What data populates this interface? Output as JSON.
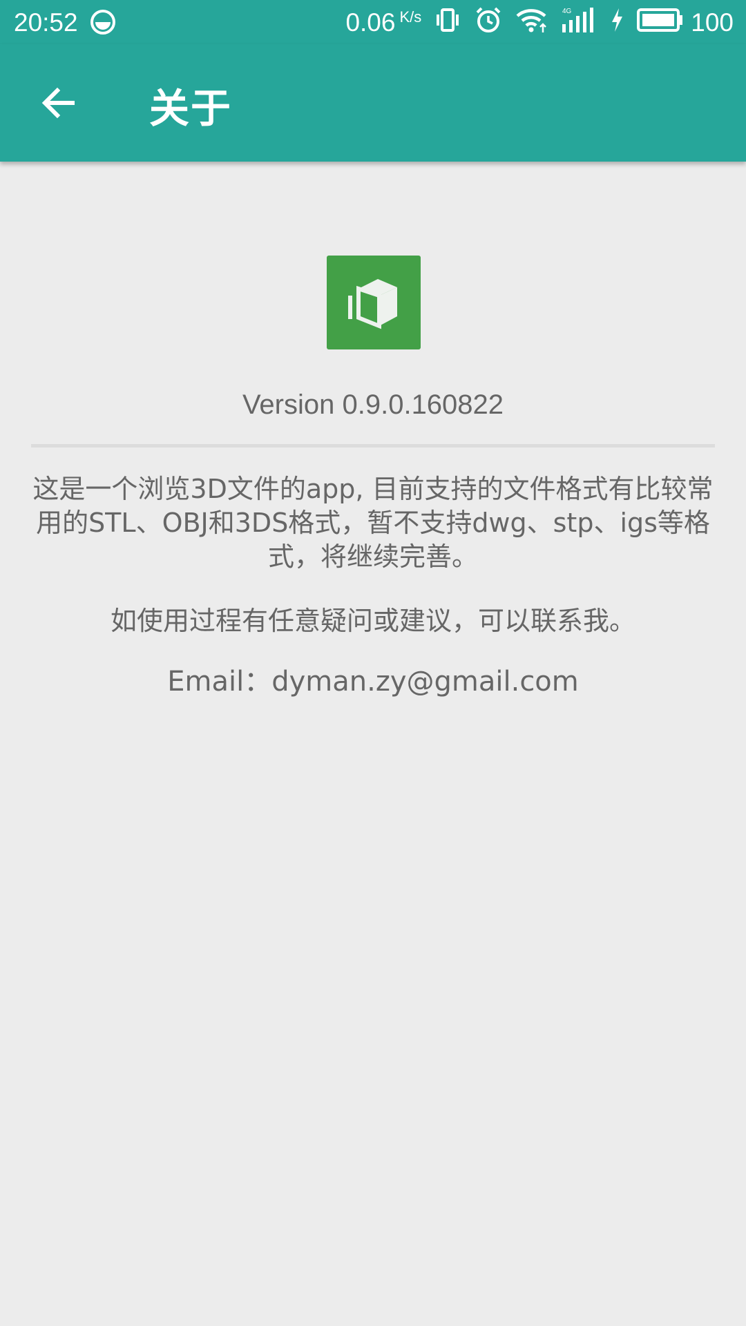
{
  "status_bar": {
    "time": "20:52",
    "net_speed": "0.06",
    "net_speed_unit": "K/s",
    "battery_percent": "100",
    "icons": [
      "notification-icon",
      "vibrate-icon",
      "alarm-icon",
      "wifi-icon",
      "4g-signal-icon",
      "charging-icon",
      "battery-icon"
    ]
  },
  "app_bar": {
    "title": "关于",
    "back_icon": "arrow-back-icon",
    "color": "#26a69a"
  },
  "about": {
    "logo_icon": "cube-icon",
    "logo_color": "#43a047",
    "version": "Version 0.9.0.160822",
    "description": "这是一个浏览3D文件的app, 目前支持的文件格式有比较常用的STL、OBJ和3DS格式，暂不支持dwg、stp、igs等格式，将继续完善。",
    "contact_hint": "如使用过程有任意疑问或建议，可以联系我。",
    "email_label": "Email：",
    "email": "dyman.zy@gmail.com"
  }
}
